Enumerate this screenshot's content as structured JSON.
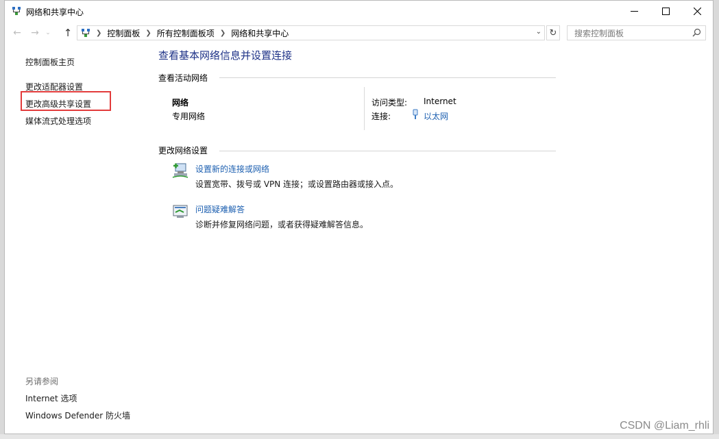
{
  "window": {
    "title": "网络和共享中心",
    "controls": {
      "minimize": "—",
      "maximize": "☐",
      "close": "✕"
    }
  },
  "navigation": {
    "back_icon": "arrow-left-icon",
    "forward_icon": "arrow-right-icon",
    "up_icon": "arrow-up-icon",
    "breadcrumbs": [
      "控制面板",
      "所有控制面板项",
      "网络和共享中心"
    ],
    "search_placeholder": "搜索控制面板"
  },
  "sidebar": {
    "home": "控制面板主页",
    "links": [
      "更改适配器设置",
      "更改高级共享设置",
      "媒体流式处理选项"
    ],
    "see_also_label": "另请参阅",
    "see_also_links": [
      "Internet 选项",
      "Windows Defender 防火墙"
    ]
  },
  "main": {
    "title": "查看基本网络信息并设置连接",
    "active_section": "查看活动网络",
    "network": {
      "name": "网络",
      "type": "专用网络",
      "access_label": "访问类型:",
      "access_value": "Internet",
      "connection_label": "连接:",
      "connection_value": "以太网"
    },
    "change_section": "更改网络设置",
    "tasks": [
      {
        "title": "设置新的连接或网络",
        "description": "设置宽带、拨号或 VPN 连接；或设置路由器或接入点。"
      },
      {
        "title": "问题疑难解答",
        "description": "诊断并修复网络问题，或者获得疑难解答信息。"
      }
    ]
  },
  "watermark": "CSDN @Liam_rhli",
  "colors": {
    "title_blue": "#1e3287",
    "link_blue": "#1c5fb0",
    "highlight_red": "#e23b3b"
  }
}
